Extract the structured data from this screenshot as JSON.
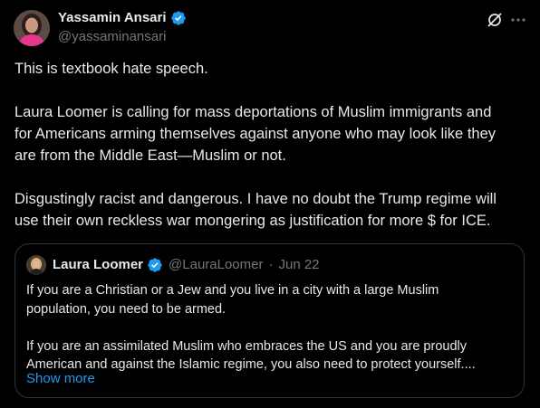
{
  "author": {
    "name": "Yassamin Ansari",
    "handle": "@yassaminansari",
    "verified": true,
    "verified_color": "#1d9bf0"
  },
  "actions": {
    "grok_icon": "grok-icon",
    "more_icon": "more-icon"
  },
  "body": {
    "p1": [
      "This is textbook hate speech."
    ],
    "p2": [
      "Laura Loomer is calling for mass deportations of Muslim immigrants and",
      "for Americans arming themselves against anyone who may look like they",
      "are from the Middle East—Muslim or not."
    ],
    "p3": [
      "Disgustingly racist and dangerous. I have no doubt the Trump regime will",
      "use their own reckless war mongering as justification for more $ for ICE."
    ]
  },
  "quote": {
    "name": "Laura Loomer",
    "verified": true,
    "handle": "@LauraLoomer",
    "separator": "·",
    "date": "Jun 22",
    "p1": [
      "If you are a Christian or a Jew and you live in a city with a large Muslim",
      "population, you need to be armed."
    ],
    "p2": [
      "If you are an assimilated Muslim who embraces the US and you are proudly",
      "American and against the Islamic regime, you also need to protect yourself...."
    ],
    "show_more": "Show more"
  },
  "colors": {
    "background": "#000000",
    "text": "#e7e9ea",
    "secondary": "#71767b",
    "link": "#1d9bf0",
    "border": "#2f3336"
  }
}
